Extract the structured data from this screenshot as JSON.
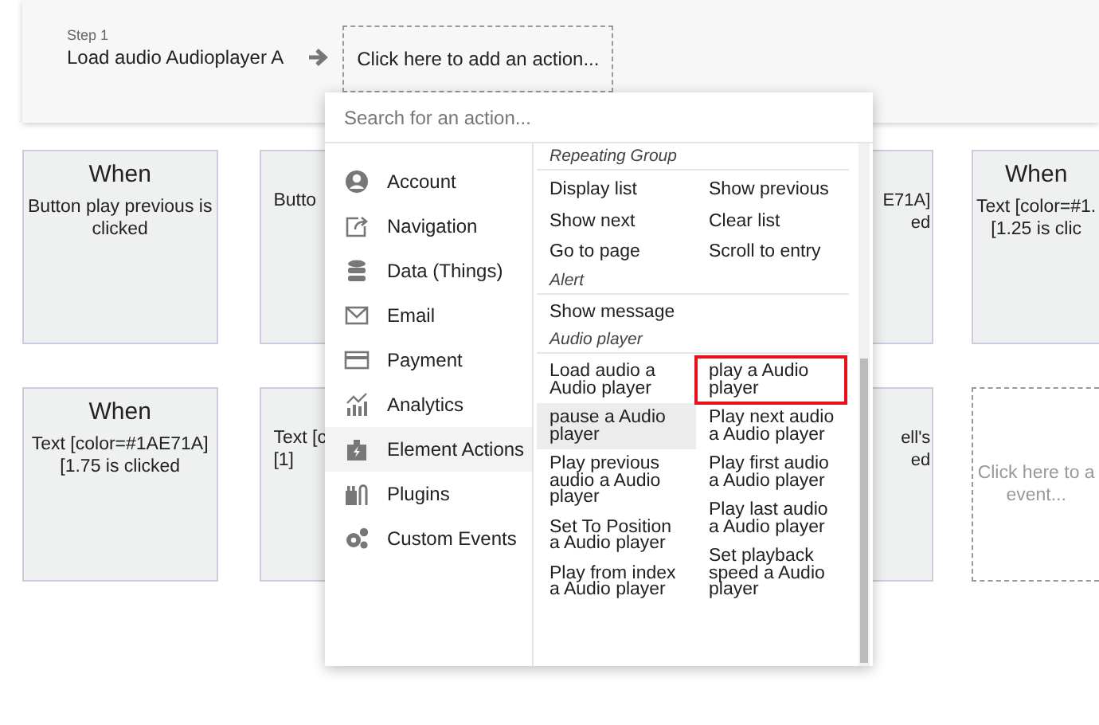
{
  "step": {
    "label": "Step 1",
    "action": "Load audio Audioplayer A",
    "add_action": "Click here to add an action..."
  },
  "card_rows": [
    [
      {
        "kind": "full",
        "title": "When",
        "lines": [
          "Button play previous is",
          "clicked"
        ]
      },
      {
        "kind": "left",
        "lines": [
          "Butto"
        ]
      },
      {
        "kind": "right",
        "lines": [
          "E71A]",
          "ed"
        ]
      },
      {
        "kind": "edge",
        "title": "When",
        "lines": [
          "Text [color=#1.",
          "[1.25 is clic"
        ]
      }
    ],
    [
      {
        "kind": "full",
        "title": "When",
        "lines": [
          "Text [color=#1AE71A]",
          "[1.75 is clicked"
        ]
      },
      {
        "kind": "left",
        "lines": [
          "Text [c",
          "[1]"
        ]
      },
      {
        "kind": "right",
        "lines": [
          "ell's",
          "ed"
        ]
      },
      {
        "kind": "empty",
        "lines": [
          "Click here to a",
          "event..."
        ]
      }
    ]
  ],
  "dropdown": {
    "search": {
      "placeholder": "Search for an action..."
    },
    "categories": [
      {
        "label": "Account",
        "selected": false
      },
      {
        "label": "Navigation",
        "selected": false
      },
      {
        "label": "Data (Things)",
        "selected": false
      },
      {
        "label": "Email",
        "selected": false
      },
      {
        "label": "Payment",
        "selected": false
      },
      {
        "label": "Analytics",
        "selected": false
      },
      {
        "label": "Element Actions",
        "selected": true
      },
      {
        "label": "Plugins",
        "selected": false
      },
      {
        "label": "Custom Events",
        "selected": false
      }
    ],
    "sections": [
      {
        "heading": "Repeating Group",
        "columns": [
          [
            {
              "label": "Display list",
              "hovered": false,
              "highlighted": false
            },
            {
              "label": "Show next",
              "hovered": false,
              "highlighted": false
            },
            {
              "label": "Go to page",
              "hovered": false,
              "highlighted": false
            }
          ],
          [
            {
              "label": "Show previous",
              "hovered": false,
              "highlighted": false
            },
            {
              "label": "Clear list",
              "hovered": false,
              "highlighted": false
            },
            {
              "label": "Scroll to entry",
              "hovered": false,
              "highlighted": false
            }
          ]
        ]
      },
      {
        "heading": "Alert",
        "columns": [
          [
            {
              "label": "Show message",
              "hovered": false,
              "highlighted": false
            }
          ]
        ]
      },
      {
        "heading": "Audio player",
        "columns": [
          [
            {
              "label": "Load audio a Audio player",
              "hovered": false,
              "highlighted": false
            },
            {
              "label": "pause a Audio player",
              "hovered": true,
              "highlighted": false
            },
            {
              "label": "Play previous audio a Audio player",
              "hovered": false,
              "highlighted": false
            },
            {
              "label": "Set To Position a Audio player",
              "hovered": false,
              "highlighted": false
            },
            {
              "label": "Play from index a Audio player",
              "hovered": false,
              "highlighted": false
            }
          ],
          [
            {
              "label": "play a Audio player",
              "hovered": false,
              "highlighted": true
            },
            {
              "label": "Play next audio a Audio player",
              "hovered": false,
              "highlighted": false
            },
            {
              "label": "Play first audio a Audio player",
              "hovered": false,
              "highlighted": false
            },
            {
              "label": "Play last audio a Audio player",
              "hovered": false,
              "highlighted": false
            },
            {
              "label": "Set playback speed a Audio player",
              "hovered": false,
              "highlighted": false
            }
          ]
        ]
      }
    ]
  }
}
